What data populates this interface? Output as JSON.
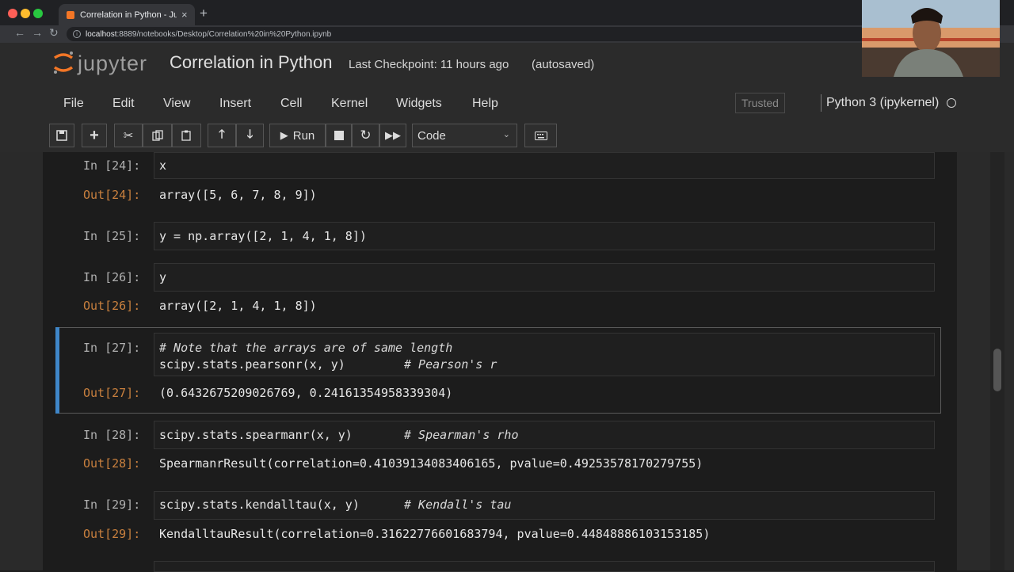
{
  "browser": {
    "tab_title": "Correlation in Python - Jupyter",
    "url_host": "localhost",
    "url_rest": ":8889/notebooks/Desktop/Correlation%20in%20Python.ipynb",
    "traffic_colors": [
      "#ff5f57",
      "#febc2e",
      "#28c840"
    ]
  },
  "header": {
    "logo_text": "jupyter",
    "notebook_title": "Correlation in Python",
    "checkpoint": "Last Checkpoint: 11 hours ago",
    "autosave": "(autosaved)",
    "trusted": "Trusted",
    "kernel": "Python 3 (ipykernel)"
  },
  "menu": [
    "File",
    "Edit",
    "View",
    "Insert",
    "Cell",
    "Kernel",
    "Widgets",
    "Help"
  ],
  "toolbar": {
    "run_label": "Run",
    "cell_type": "Code"
  },
  "cells": [
    {
      "in_prompt": "In [24]:",
      "code": "x",
      "out_prompt": "Out[24]:",
      "output": "array([5, 6, 7, 8, 9])"
    },
    {
      "in_prompt": "In [25]:",
      "code": "y = np.array([2, 1, 4, 1, 8])"
    },
    {
      "in_prompt": "In [26]:",
      "code": "y",
      "out_prompt": "Out[26]:",
      "output": "array([2, 1, 4, 1, 8])"
    },
    {
      "in_prompt": "In [27]:",
      "comment_line": "# Note that the arrays are of same length",
      "code": "scipy.stats.pearsonr(x, y)",
      "comment": "# Pearson's r",
      "out_prompt": "Out[27]:",
      "output": "(0.6432675209026769, 0.24161354958339304)"
    },
    {
      "in_prompt": "In [28]:",
      "code": "scipy.stats.spearmanr(x, y)",
      "comment": "# Spearman's rho",
      "out_prompt": "Out[28]:",
      "output": "SpearmanrResult(correlation=0.41039134083406165, pvalue=0.49253578170279755)"
    },
    {
      "in_prompt": "In [29]:",
      "code": "scipy.stats.kendalltau(x, y)",
      "comment": "# Kendall's tau",
      "out_prompt": "Out[29]:",
      "output": "KendalltauResult(correlation=0.31622776601683794, pvalue=0.44848886103153185)"
    }
  ]
}
